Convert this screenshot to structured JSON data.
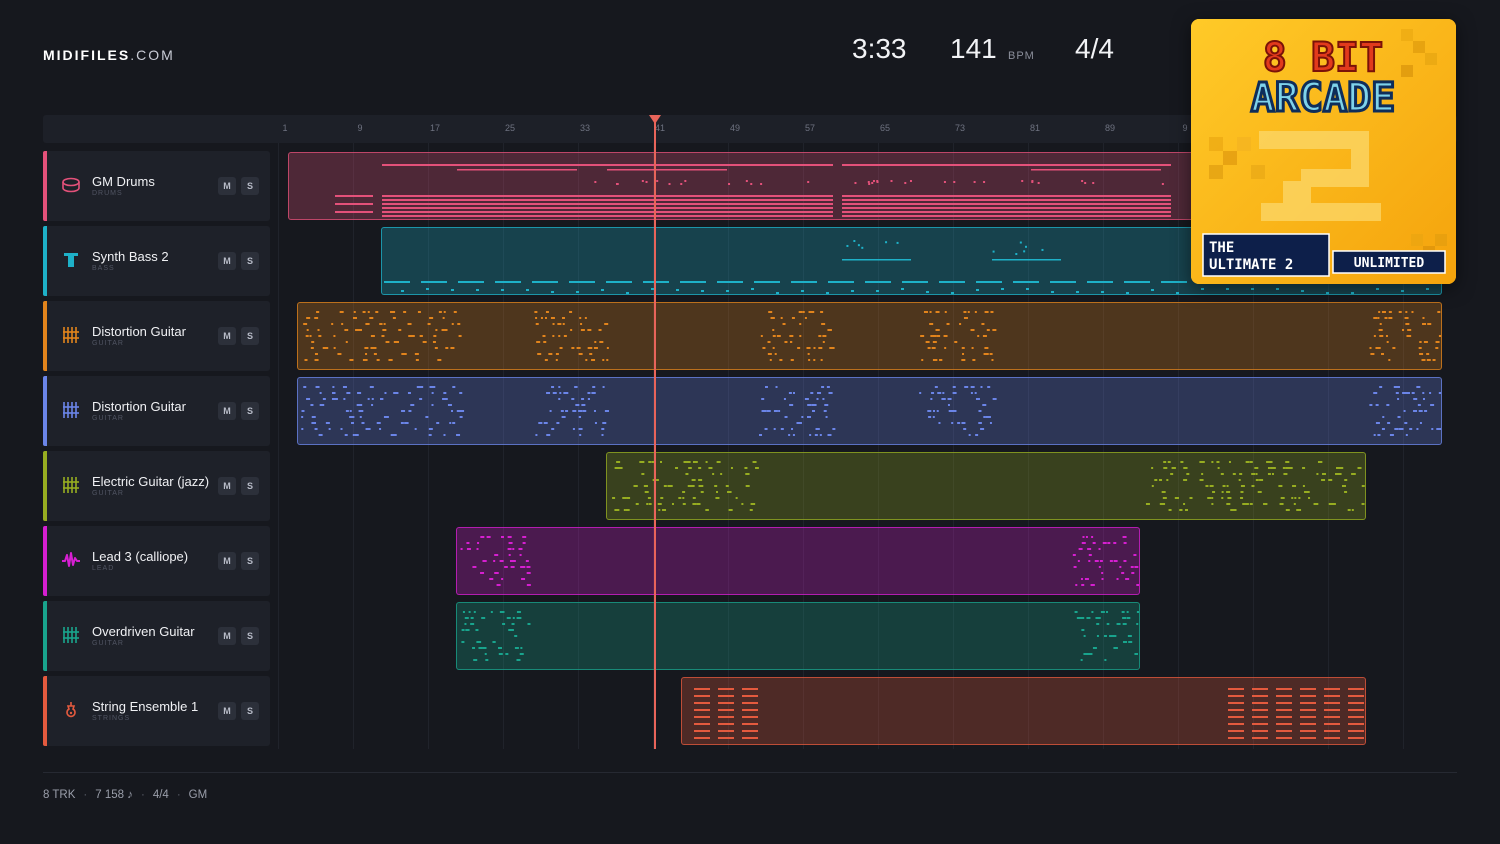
{
  "brand": {
    "name_bold": "MIDIFILES",
    "name_light": ".COM"
  },
  "transport": {
    "time": "3:33",
    "tempo": "141",
    "tempo_unit": "BPM",
    "signature": "4/4"
  },
  "ruler": {
    "bars": [
      "1",
      "9",
      "17",
      "25",
      "33",
      "41",
      "49",
      "57",
      "65",
      "73",
      "81",
      "89",
      "9"
    ]
  },
  "playhead_bar": 41,
  "tracks": [
    {
      "name": "GM Drums",
      "category": "DRUMS",
      "color": "#e4517a",
      "icon": "drum-icon",
      "mute": "M",
      "solo": "S"
    },
    {
      "name": "Synth Bass 2",
      "category": "BASS",
      "color": "#1eb1c8",
      "icon": "bass-icon",
      "mute": "M",
      "solo": "S"
    },
    {
      "name": "Distortion Guitar",
      "category": "GUITAR",
      "color": "#e2841c",
      "icon": "guitar-icon",
      "mute": "M",
      "solo": "S"
    },
    {
      "name": "Distortion Guitar",
      "category": "GUITAR",
      "color": "#6b85e8",
      "icon": "guitar-icon",
      "mute": "M",
      "solo": "S"
    },
    {
      "name": "Electric Guitar (jazz)",
      "category": "GUITAR",
      "color": "#97ad21",
      "icon": "guitar-icon",
      "mute": "M",
      "solo": "S"
    },
    {
      "name": "Lead 3 (calliope)",
      "category": "LEAD",
      "color": "#d61fd1",
      "icon": "waveform-icon",
      "mute": "M",
      "solo": "S"
    },
    {
      "name": "Overdriven Guitar",
      "category": "GUITAR",
      "color": "#19a48d",
      "icon": "guitar-icon",
      "mute": "M",
      "solo": "S"
    },
    {
      "name": "String Ensemble 1",
      "category": "STRINGS",
      "color": "#e45a3e",
      "icon": "violin-icon",
      "mute": "M",
      "solo": "S"
    }
  ],
  "footer": {
    "tracks": "8 TRK",
    "notes": "7 158 ♪",
    "signature": "4/4",
    "standard": "GM"
  },
  "album": {
    "title_line1": "8 BIT",
    "title_line2": "ARCADE",
    "subtitle_a": "THE",
    "subtitle_b": "ULTIMATE 2",
    "subtitle_c": "UNLIMITED"
  }
}
